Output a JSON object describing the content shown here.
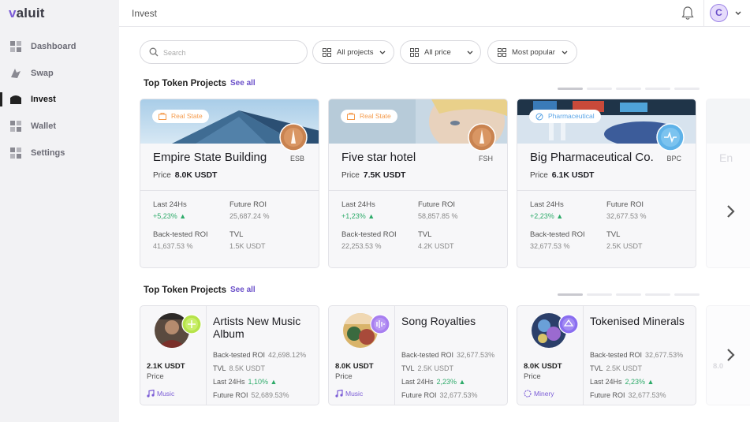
{
  "brand": {
    "logo_v": "v",
    "logo_rest": "aluit"
  },
  "sidebar": {
    "items": [
      {
        "label": "Dashboard",
        "icon": "dashboard-icon"
      },
      {
        "label": "Swap",
        "icon": "swap-icon"
      },
      {
        "label": "Invest",
        "icon": "invest-icon",
        "active": true
      },
      {
        "label": "Wallet",
        "icon": "wallet-icon"
      },
      {
        "label": "Settings",
        "icon": "settings-icon"
      }
    ]
  },
  "header": {
    "title": "Invest",
    "avatar_initial": "C"
  },
  "filters": {
    "search_placeholder": "Search",
    "projects": "All projects",
    "price": "All price",
    "sort": "Most popular"
  },
  "colors": {
    "accent": "#6a4fc9",
    "positive": "#2eab6a",
    "sidebar_bg": "#f2f2f4"
  },
  "section1": {
    "title": "Top Token Projects",
    "see_all": "See all",
    "cards": [
      {
        "tag": "Real State",
        "tag_color": "#f59b4c",
        "name": "Empire State Building",
        "ticker": "ESB",
        "price_label": "Price",
        "price": "8.0K USDT",
        "l24_label": "Last 24Hs",
        "l24": "+5,23% ▲",
        "froi_label": "Future ROI",
        "froi": "25,687.24 %",
        "bt_label": "Back-tested ROI",
        "bt": "41,637.53 %",
        "tvl_label": "TVL",
        "tvl": "1.5K USDT"
      },
      {
        "tag": "Real State",
        "tag_color": "#f59b4c",
        "name": "Five star hotel",
        "ticker": "FSH",
        "price_label": "Price",
        "price": "7.5K USDT",
        "l24_label": "Last 24Hs",
        "l24": "+1,23% ▲",
        "froi_label": "Future ROI",
        "froi": "58,857.85 %",
        "bt_label": "Back-tested ROI",
        "bt": "22,253.53 %",
        "tvl_label": "TVL",
        "tvl": "4.2K USDT"
      },
      {
        "tag": "Pharmaceutical",
        "tag_color": "#5aa4e6",
        "name": "Big Pharmaceutical Co.",
        "ticker": "BPC",
        "price_label": "Price",
        "price": "6.1K USDT",
        "l24_label": "Last 24Hs",
        "l24": "+2,23% ▲",
        "froi_label": "Future ROI",
        "froi": "32,677.53 %",
        "bt_label": "Back-tested ROI",
        "bt": "32,677.53 %",
        "tvl_label": "TVL",
        "tvl": "2.5K USDT"
      }
    ],
    "ghost_name": "En"
  },
  "section2": {
    "title": "Top Token Projects",
    "see_all": "See all",
    "cards": [
      {
        "name": "Artists New Music Album",
        "price": "2.1K USDT",
        "price_label": "Price",
        "category": "Music",
        "bt_label": "Back-tested ROI",
        "bt": "42,698.12%",
        "tvl_label": "TVL",
        "tvl": "8.5K USDT",
        "l24_label": "Last 24Hs",
        "l24": "1,10% ▲",
        "froi_label": "Future ROI",
        "froi": "52,689.53%"
      },
      {
        "name": "Song Royalties",
        "price": "8.0K USDT",
        "price_label": "Price",
        "category": "Music",
        "bt_label": "Back-tested ROI",
        "bt": "32,677.53%",
        "tvl_label": "TVL",
        "tvl": "2.5K USDT",
        "l24_label": "Last 24Hs",
        "l24": "2,23% ▲",
        "froi_label": "Future ROI",
        "froi": "32,677.53%"
      },
      {
        "name": "Tokenised Minerals",
        "price": "8.0K USDT",
        "price_label": "Price",
        "category": "Minery",
        "bt_label": "Back-tested ROI",
        "bt": "32,677.53%",
        "tvl_label": "TVL",
        "tvl": "2.5K USDT",
        "l24_label": "Last 24Hs",
        "l24": "2,23% ▲",
        "froi_label": "Future ROI",
        "froi": "32,677.53%"
      }
    ],
    "ghost_price": "8.0"
  }
}
